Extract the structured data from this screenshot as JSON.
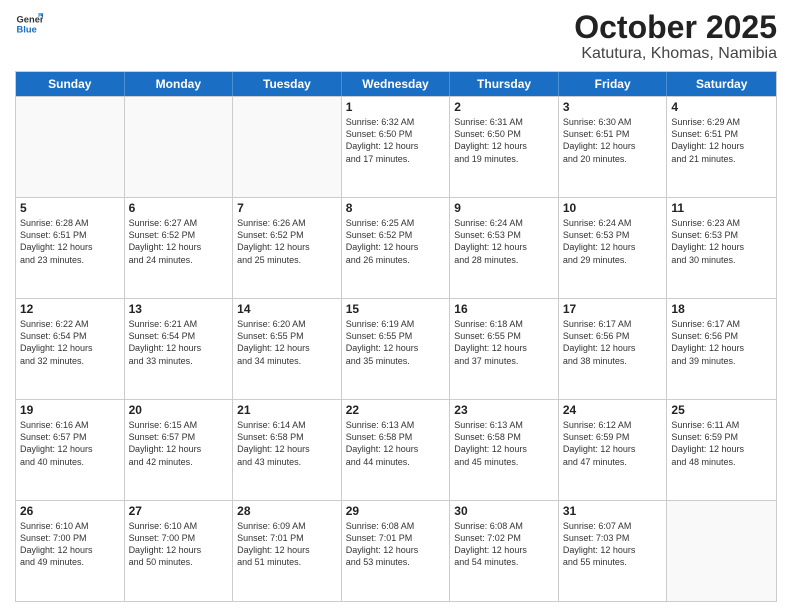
{
  "logo": {
    "line1": "General",
    "line2": "Blue"
  },
  "title": "October 2025",
  "location": "Katutura, Khomas, Namibia",
  "weekdays": [
    "Sunday",
    "Monday",
    "Tuesday",
    "Wednesday",
    "Thursday",
    "Friday",
    "Saturday"
  ],
  "weeks": [
    [
      {
        "day": "",
        "info": ""
      },
      {
        "day": "",
        "info": ""
      },
      {
        "day": "",
        "info": ""
      },
      {
        "day": "1",
        "info": "Sunrise: 6:32 AM\nSunset: 6:50 PM\nDaylight: 12 hours\nand 17 minutes."
      },
      {
        "day": "2",
        "info": "Sunrise: 6:31 AM\nSunset: 6:50 PM\nDaylight: 12 hours\nand 19 minutes."
      },
      {
        "day": "3",
        "info": "Sunrise: 6:30 AM\nSunset: 6:51 PM\nDaylight: 12 hours\nand 20 minutes."
      },
      {
        "day": "4",
        "info": "Sunrise: 6:29 AM\nSunset: 6:51 PM\nDaylight: 12 hours\nand 21 minutes."
      }
    ],
    [
      {
        "day": "5",
        "info": "Sunrise: 6:28 AM\nSunset: 6:51 PM\nDaylight: 12 hours\nand 23 minutes."
      },
      {
        "day": "6",
        "info": "Sunrise: 6:27 AM\nSunset: 6:52 PM\nDaylight: 12 hours\nand 24 minutes."
      },
      {
        "day": "7",
        "info": "Sunrise: 6:26 AM\nSunset: 6:52 PM\nDaylight: 12 hours\nand 25 minutes."
      },
      {
        "day": "8",
        "info": "Sunrise: 6:25 AM\nSunset: 6:52 PM\nDaylight: 12 hours\nand 26 minutes."
      },
      {
        "day": "9",
        "info": "Sunrise: 6:24 AM\nSunset: 6:53 PM\nDaylight: 12 hours\nand 28 minutes."
      },
      {
        "day": "10",
        "info": "Sunrise: 6:24 AM\nSunset: 6:53 PM\nDaylight: 12 hours\nand 29 minutes."
      },
      {
        "day": "11",
        "info": "Sunrise: 6:23 AM\nSunset: 6:53 PM\nDaylight: 12 hours\nand 30 minutes."
      }
    ],
    [
      {
        "day": "12",
        "info": "Sunrise: 6:22 AM\nSunset: 6:54 PM\nDaylight: 12 hours\nand 32 minutes."
      },
      {
        "day": "13",
        "info": "Sunrise: 6:21 AM\nSunset: 6:54 PM\nDaylight: 12 hours\nand 33 minutes."
      },
      {
        "day": "14",
        "info": "Sunrise: 6:20 AM\nSunset: 6:55 PM\nDaylight: 12 hours\nand 34 minutes."
      },
      {
        "day": "15",
        "info": "Sunrise: 6:19 AM\nSunset: 6:55 PM\nDaylight: 12 hours\nand 35 minutes."
      },
      {
        "day": "16",
        "info": "Sunrise: 6:18 AM\nSunset: 6:55 PM\nDaylight: 12 hours\nand 37 minutes."
      },
      {
        "day": "17",
        "info": "Sunrise: 6:17 AM\nSunset: 6:56 PM\nDaylight: 12 hours\nand 38 minutes."
      },
      {
        "day": "18",
        "info": "Sunrise: 6:17 AM\nSunset: 6:56 PM\nDaylight: 12 hours\nand 39 minutes."
      }
    ],
    [
      {
        "day": "19",
        "info": "Sunrise: 6:16 AM\nSunset: 6:57 PM\nDaylight: 12 hours\nand 40 minutes."
      },
      {
        "day": "20",
        "info": "Sunrise: 6:15 AM\nSunset: 6:57 PM\nDaylight: 12 hours\nand 42 minutes."
      },
      {
        "day": "21",
        "info": "Sunrise: 6:14 AM\nSunset: 6:58 PM\nDaylight: 12 hours\nand 43 minutes."
      },
      {
        "day": "22",
        "info": "Sunrise: 6:13 AM\nSunset: 6:58 PM\nDaylight: 12 hours\nand 44 minutes."
      },
      {
        "day": "23",
        "info": "Sunrise: 6:13 AM\nSunset: 6:58 PM\nDaylight: 12 hours\nand 45 minutes."
      },
      {
        "day": "24",
        "info": "Sunrise: 6:12 AM\nSunset: 6:59 PM\nDaylight: 12 hours\nand 47 minutes."
      },
      {
        "day": "25",
        "info": "Sunrise: 6:11 AM\nSunset: 6:59 PM\nDaylight: 12 hours\nand 48 minutes."
      }
    ],
    [
      {
        "day": "26",
        "info": "Sunrise: 6:10 AM\nSunset: 7:00 PM\nDaylight: 12 hours\nand 49 minutes."
      },
      {
        "day": "27",
        "info": "Sunrise: 6:10 AM\nSunset: 7:00 PM\nDaylight: 12 hours\nand 50 minutes."
      },
      {
        "day": "28",
        "info": "Sunrise: 6:09 AM\nSunset: 7:01 PM\nDaylight: 12 hours\nand 51 minutes."
      },
      {
        "day": "29",
        "info": "Sunrise: 6:08 AM\nSunset: 7:01 PM\nDaylight: 12 hours\nand 53 minutes."
      },
      {
        "day": "30",
        "info": "Sunrise: 6:08 AM\nSunset: 7:02 PM\nDaylight: 12 hours\nand 54 minutes."
      },
      {
        "day": "31",
        "info": "Sunrise: 6:07 AM\nSunset: 7:03 PM\nDaylight: 12 hours\nand 55 minutes."
      },
      {
        "day": "",
        "info": ""
      }
    ]
  ]
}
